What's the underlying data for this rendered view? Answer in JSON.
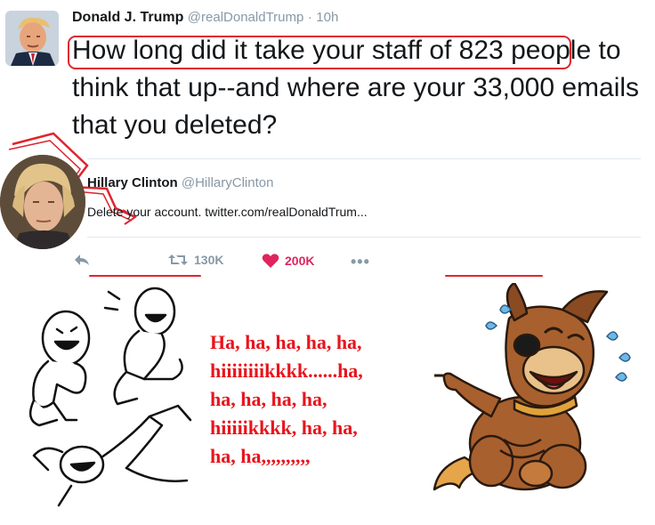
{
  "tweet": {
    "author_name": "Donald J. Trump",
    "author_handle": "@realDonaldTrump",
    "separator": "·",
    "time": "10h",
    "body": "How long did it take your staff of 823 people to think that up--and where are your 33,000 emails that you deleted?"
  },
  "quoted_tweet": {
    "author_name": "Hillary Clinton",
    "author_handle": "@HillaryClinton",
    "text": "Delete your account. twitter.com/realDonaldTrum..."
  },
  "actions": {
    "retweets": "130K",
    "likes": "200K",
    "more": "•••"
  },
  "meme": {
    "lines": [
      "Ha, ha, ha, ha, ha,",
      "hiiiiiiiikkkk......ha,",
      "ha, ha, ha, ha,",
      "hiiiiikkkk, ha, ha,",
      "ha, ha,,,,,,,,,,"
    ]
  },
  "colors": {
    "annotation_red": "#e0242e",
    "like_red": "#e0245e",
    "muted_gray": "#8899a6",
    "meme_red": "#e8141c"
  },
  "icons": [
    "reply-icon",
    "retweet-icon",
    "heart-icon",
    "more-icon"
  ]
}
